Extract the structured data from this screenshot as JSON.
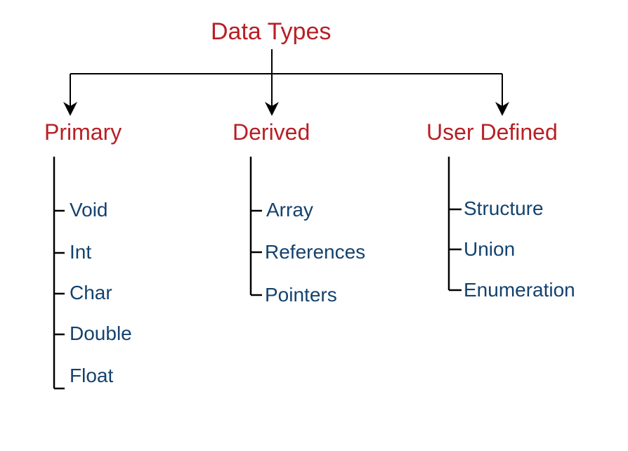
{
  "root": "Data Types",
  "categories": [
    {
      "name": "Primary",
      "leaves": [
        "Void",
        "Int",
        "Char",
        "Double",
        "Float"
      ]
    },
    {
      "name": "Derived",
      "leaves": [
        "Array",
        "References",
        "Pointers"
      ]
    },
    {
      "name": "User Defined",
      "leaves": [
        "Structure",
        "Union",
        "Enumeration"
      ]
    }
  ]
}
